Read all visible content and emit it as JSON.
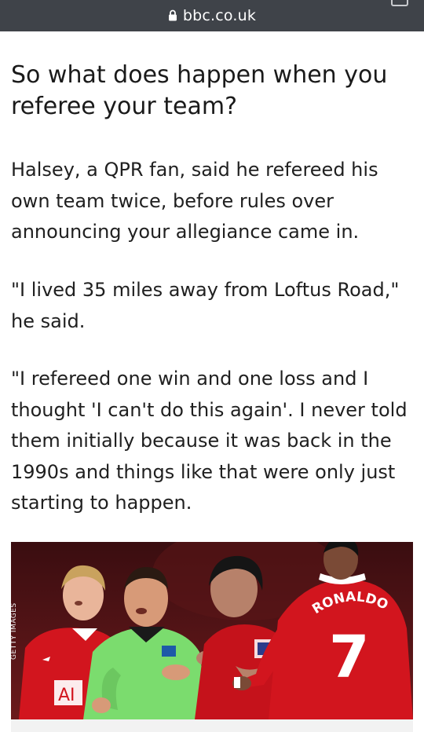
{
  "browser": {
    "url": "bbc.co.uk"
  },
  "article": {
    "headline": "So what does happen when you referee your team?",
    "paragraphs": [
      "Halsey, a QPR fan, said he refereed his own team twice, before rules over announcing your allegiance came in.",
      "\"I lived 35 miles away from Loftus Road,\" he said.",
      "\"I refereed one win and one loss and I thought 'I can't do this again'. I never told them initially because it was back in the 1990s and things like that were only just starting to happen."
    ],
    "image": {
      "credit": "GETTY IMAGES",
      "shirt_name": "RONALDO",
      "shirt_number": "7",
      "shirt_badge_text": "AI"
    }
  },
  "colors": {
    "topbar": "#3f4349",
    "united_red": "#d2151e",
    "referee_green": "#7bdc6e"
  }
}
